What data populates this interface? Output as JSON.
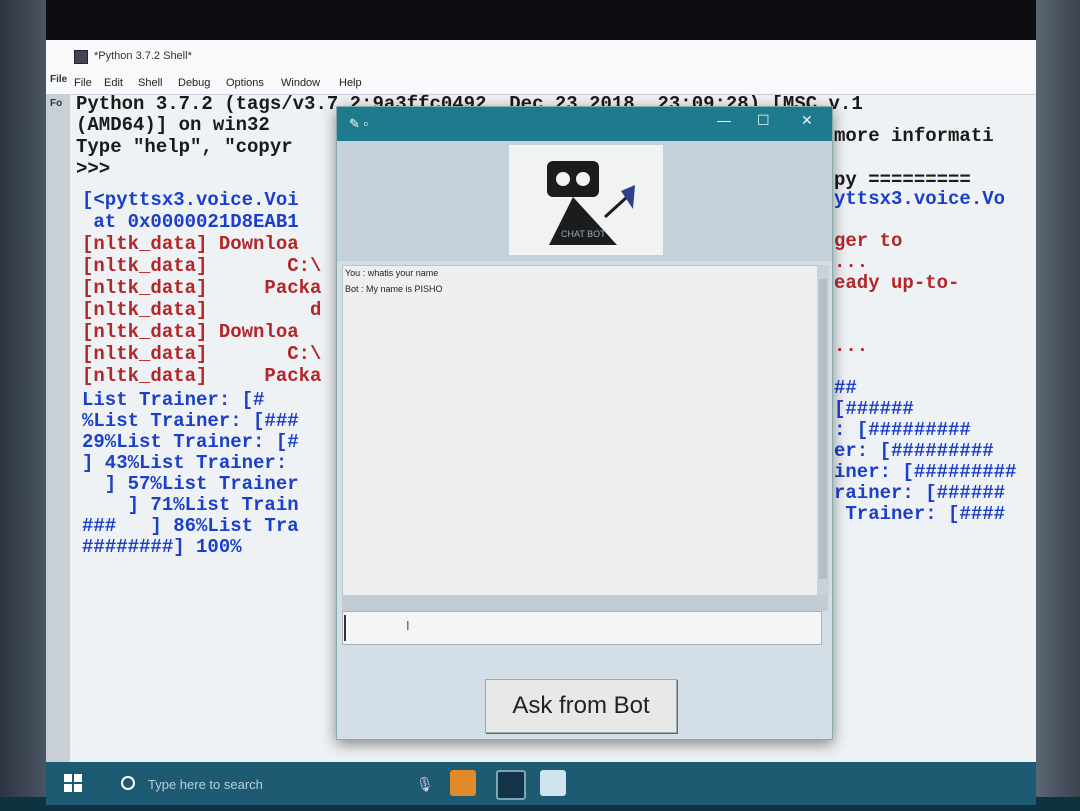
{
  "shell": {
    "title": "*Python 3.7.2 Shell*",
    "menu": [
      "File",
      "Edit",
      "Shell",
      "Debug",
      "Options",
      "Window",
      "Help"
    ],
    "left_lines": [
      {
        "text": "Python 3.7.2 (tags/v3.7.2:9a3ffc0492, Dec 23 2018, 23:09:28) [MSC v.1",
        "color": "blk"
      },
      {
        "text": "(AMD64)] on win32",
        "color": "blk"
      },
      {
        "text": "Type \"help\", \"copyr",
        "color": "blk"
      },
      {
        "text": ">>>",
        "color": "blk"
      },
      {
        "text": "[<pyttsx3.voice.Voi",
        "color": "blu"
      },
      {
        "text": " at 0x0000021D8EAB1",
        "color": "blu"
      },
      {
        "text": "[nltk_data] Downloa",
        "color": "red"
      },
      {
        "text": "[nltk_data]       C:\\",
        "color": "red"
      },
      {
        "text": "[nltk_data]     Packa",
        "color": "red"
      },
      {
        "text": "[nltk_data]         d",
        "color": "red"
      },
      {
        "text": "[nltk_data] Downloa",
        "color": "red"
      },
      {
        "text": "[nltk_data]       C:\\",
        "color": "red"
      },
      {
        "text": "[nltk_data]     Packa",
        "color": "red"
      },
      {
        "text": "List Trainer: [#",
        "color": "blu"
      },
      {
        "text": "%List Trainer: [###",
        "color": "blu"
      },
      {
        "text": "29%List Trainer: [#",
        "color": "blu"
      },
      {
        "text": "] 43%List Trainer:",
        "color": "blu"
      },
      {
        "text": "  ] 57%List Trainer",
        "color": "blu"
      },
      {
        "text": "    ] 71%List Train",
        "color": "blu"
      },
      {
        "text": "###   ] 86%List Tra",
        "color": "blu"
      },
      {
        "text": "########] 100%",
        "color": "blu"
      }
    ],
    "right_lines": [
      {
        "text": "more informati",
        "color": "blk",
        "row": 1.5
      },
      {
        "text": "py =========",
        "color": "blk",
        "row": 3.6
      },
      {
        "text": "yttsx3.voice.Vo",
        "color": "blu",
        "row": 4.5
      },
      {
        "text": "ger to",
        "color": "red",
        "row": 6.5
      },
      {
        "text": "...",
        "color": "red",
        "row": 7.5
      },
      {
        "text": "eady up-to-",
        "color": "red",
        "row": 8.5
      },
      {
        "text": "...",
        "color": "red",
        "row": 11.5
      },
      {
        "text": "##",
        "color": "blu",
        "row": 13.5
      },
      {
        "text": "[######",
        "color": "blu",
        "row": 14.5
      },
      {
        "text": ": [#########",
        "color": "blu",
        "row": 15.5
      },
      {
        "text": "er: [#########",
        "color": "blu",
        "row": 16.5
      },
      {
        "text": "iner: [#########",
        "color": "blu",
        "row": 17.5
      },
      {
        "text": "rainer: [######",
        "color": "blu",
        "row": 18.5
      },
      {
        "text": " Trainer: [####",
        "color": "blu",
        "row": 19.5
      }
    ],
    "gutter_labels": [
      "File",
      "Fo"
    ]
  },
  "taskbar": {
    "search_placeholder": "Type here to search"
  },
  "bot_window": {
    "icon": "feather-icon",
    "window_buttons": [
      "—",
      "☐",
      "✕"
    ],
    "messages": [
      "You : whatis your name",
      "Bot : My name is PISHO"
    ],
    "input_value": "",
    "ask_button_label": "Ask from Bot",
    "logo_text": "CHAT BOT"
  },
  "colors": {
    "blk": "#1a1a1a",
    "blu": "#1b3fc9",
    "red": "#b3262a",
    "titlebar": "#1e7b8e",
    "taskbar": "#1f5a73"
  }
}
